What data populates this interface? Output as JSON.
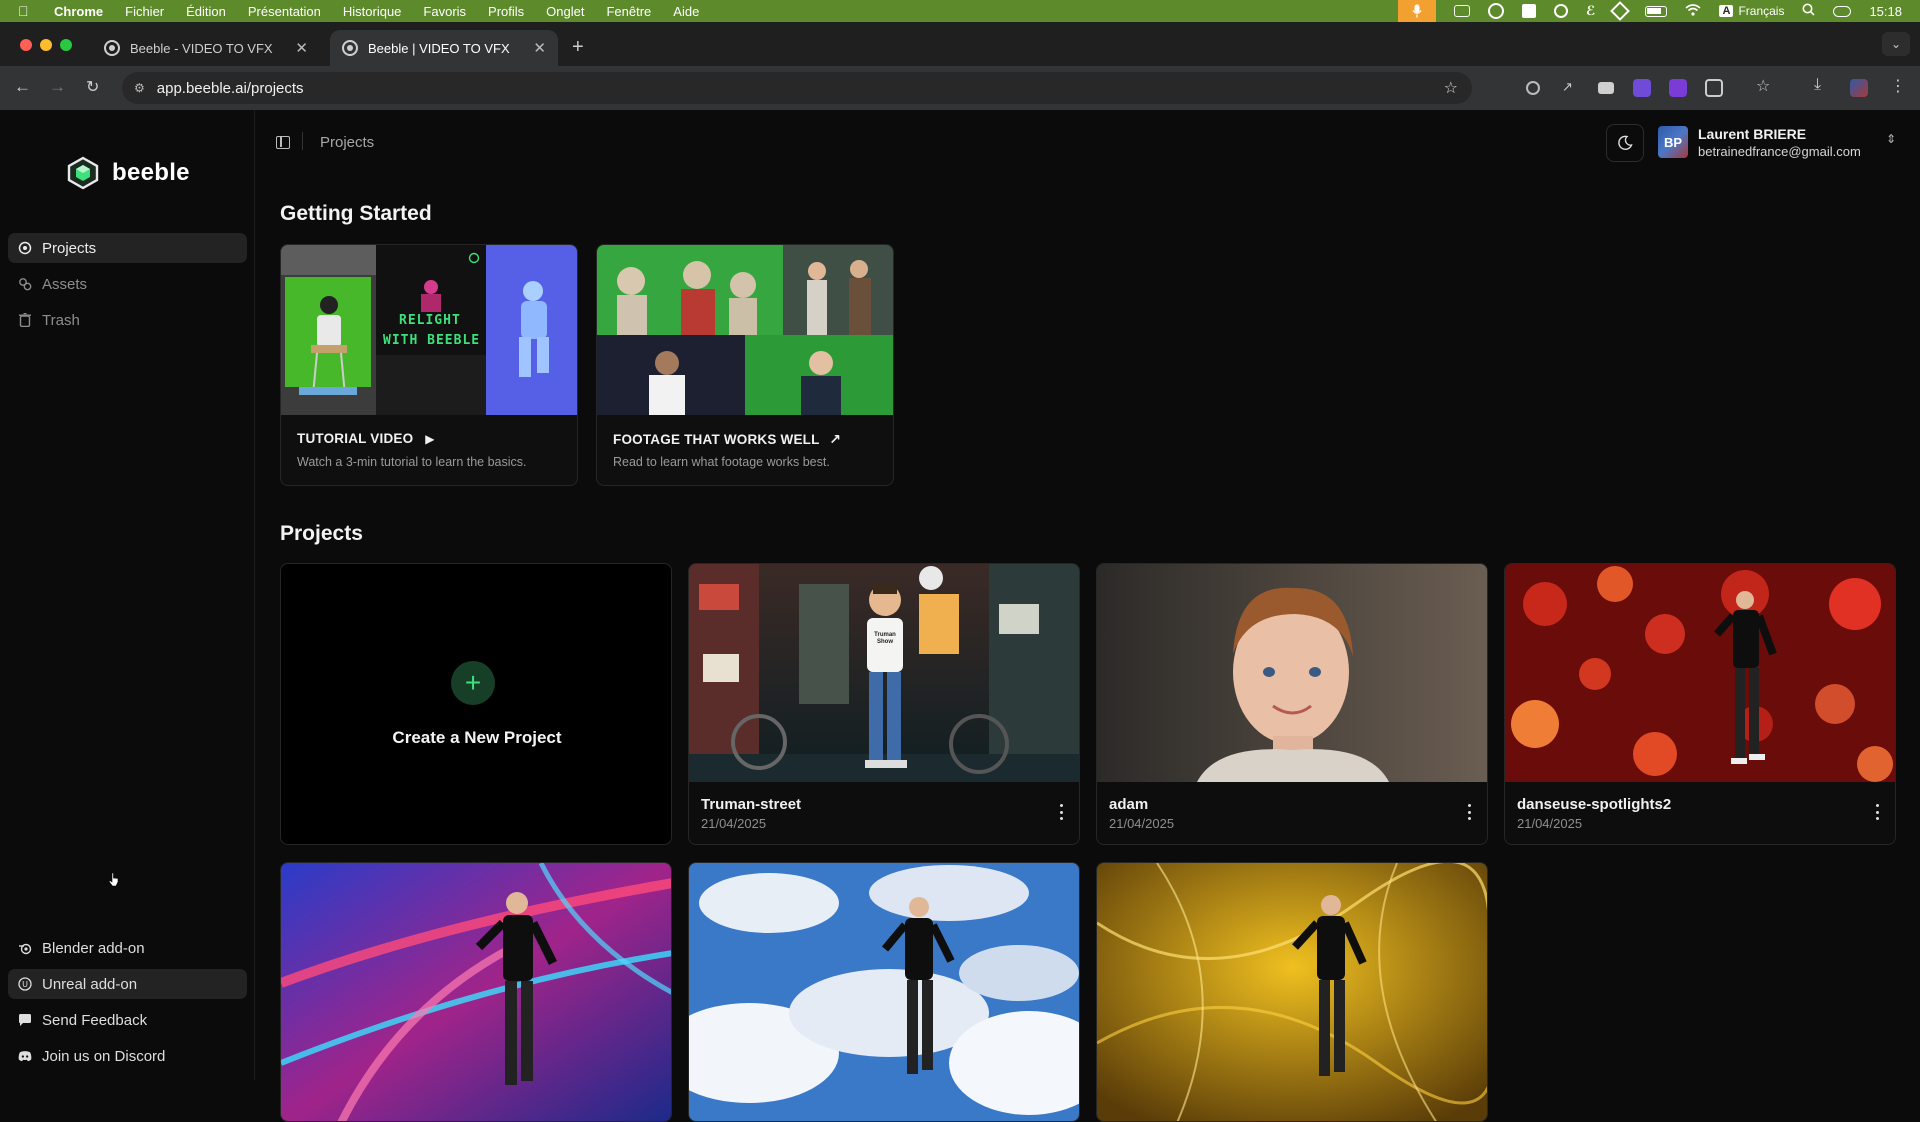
{
  "menubar": {
    "app": "Chrome",
    "items": [
      "Fichier",
      "Édition",
      "Présentation",
      "Historique",
      "Favoris",
      "Profils",
      "Onglet",
      "Fenêtre",
      "Aide"
    ],
    "keyboard_badge": "A",
    "language": "Français",
    "time": "15:18"
  },
  "browser": {
    "tabs": [
      {
        "title": "Beeble - VIDEO TO VFX",
        "active": false
      },
      {
        "title": "Beeble | VIDEO TO VFX",
        "active": true
      }
    ],
    "url": "app.beeble.ai/projects"
  },
  "sidebar": {
    "brand": "beeble",
    "nav": [
      {
        "label": "Projects",
        "icon": "projects-icon",
        "active": true
      },
      {
        "label": "Assets",
        "icon": "assets-icon",
        "active": false
      },
      {
        "label": "Trash",
        "icon": "trash-icon",
        "active": false
      }
    ],
    "footer": [
      {
        "label": "Blender add-on",
        "icon": "blender-icon"
      },
      {
        "label": "Unreal add-on",
        "icon": "unreal-icon"
      },
      {
        "label": "Send Feedback",
        "icon": "feedback-icon"
      },
      {
        "label": "Join us on Discord",
        "icon": "discord-icon"
      }
    ]
  },
  "header": {
    "breadcrumb": "Projects",
    "user": {
      "initials": "BP",
      "name": "Laurent BRIERE",
      "email": "betrainedfrance@gmail.com"
    }
  },
  "getting_started": {
    "title": "Getting Started",
    "cards": [
      {
        "title": "TUTORIAL VIDEO",
        "title_icon": "play-icon",
        "description": "Watch a 3-min tutorial to learn the basics.",
        "overlay_text_1": "RELIGHT",
        "overlay_text_2": "WITH BEEBLE"
      },
      {
        "title": "FOOTAGE THAT WORKS WELL",
        "title_icon": "external-arrow-icon",
        "description": "Read to learn what footage works best."
      }
    ]
  },
  "projects": {
    "title": "Projects",
    "create_label": "Create a New Project",
    "shirt_text": "Truman Show",
    "items": [
      {
        "name": "Truman-street",
        "date": "21/04/2025"
      },
      {
        "name": "adam",
        "date": "21/04/2025"
      },
      {
        "name": "danseuse-spotlights2",
        "date": "21/04/2025"
      }
    ]
  },
  "colors": {
    "accent": "#3ee07b",
    "menubar": "#5d8a2a",
    "background": "#0b0b0b"
  }
}
